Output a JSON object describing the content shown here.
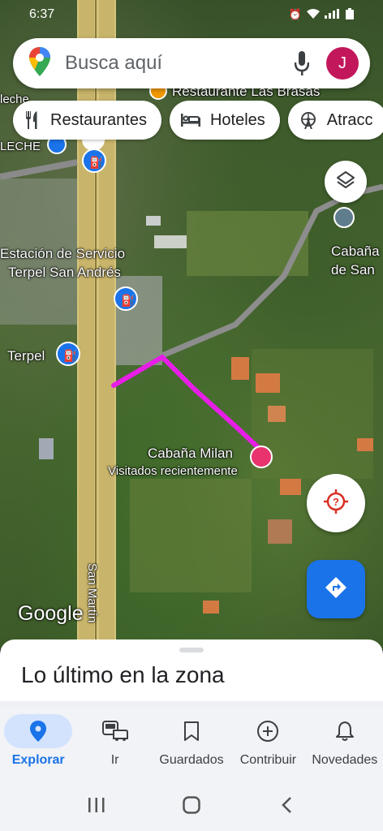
{
  "status": {
    "time": "6:37"
  },
  "search": {
    "placeholder": "Busca aquí",
    "avatar_letter": "J"
  },
  "chips": [
    {
      "label": "Restaurantes",
      "icon": "fork-knife-icon"
    },
    {
      "label": "Hoteles",
      "icon": "bed-icon"
    },
    {
      "label": "Atracc",
      "icon": "ferris-wheel-icon"
    }
  ],
  "map": {
    "labels": {
      "leche": "leche",
      "leche_upper": "LECHE",
      "restaurante": "Restaurante Las Brasas",
      "estacion": "Estación de Servicio",
      "terpel_san_andres": "Terpel San Andrés",
      "terpel": "Terpel",
      "cabana_san": "Cabaña",
      "cabana_san_2": "de San",
      "cabana_milan": "Cabaña Milan",
      "visitados": "Visitados recientemente",
      "street": "San Martín"
    },
    "route_color": "#e61ee6",
    "logo": "Google"
  },
  "sheet": {
    "title": "Lo último en la zona"
  },
  "nav": [
    {
      "label": "Explorar",
      "icon": "location-pin-icon",
      "active": true
    },
    {
      "label": "Ir",
      "icon": "commute-icon",
      "active": false
    },
    {
      "label": "Guardados",
      "icon": "bookmark-icon",
      "active": false
    },
    {
      "label": "Contribuir",
      "icon": "add-circle-icon",
      "active": false
    },
    {
      "label": "Novedades",
      "icon": "bell-icon",
      "active": false
    }
  ]
}
